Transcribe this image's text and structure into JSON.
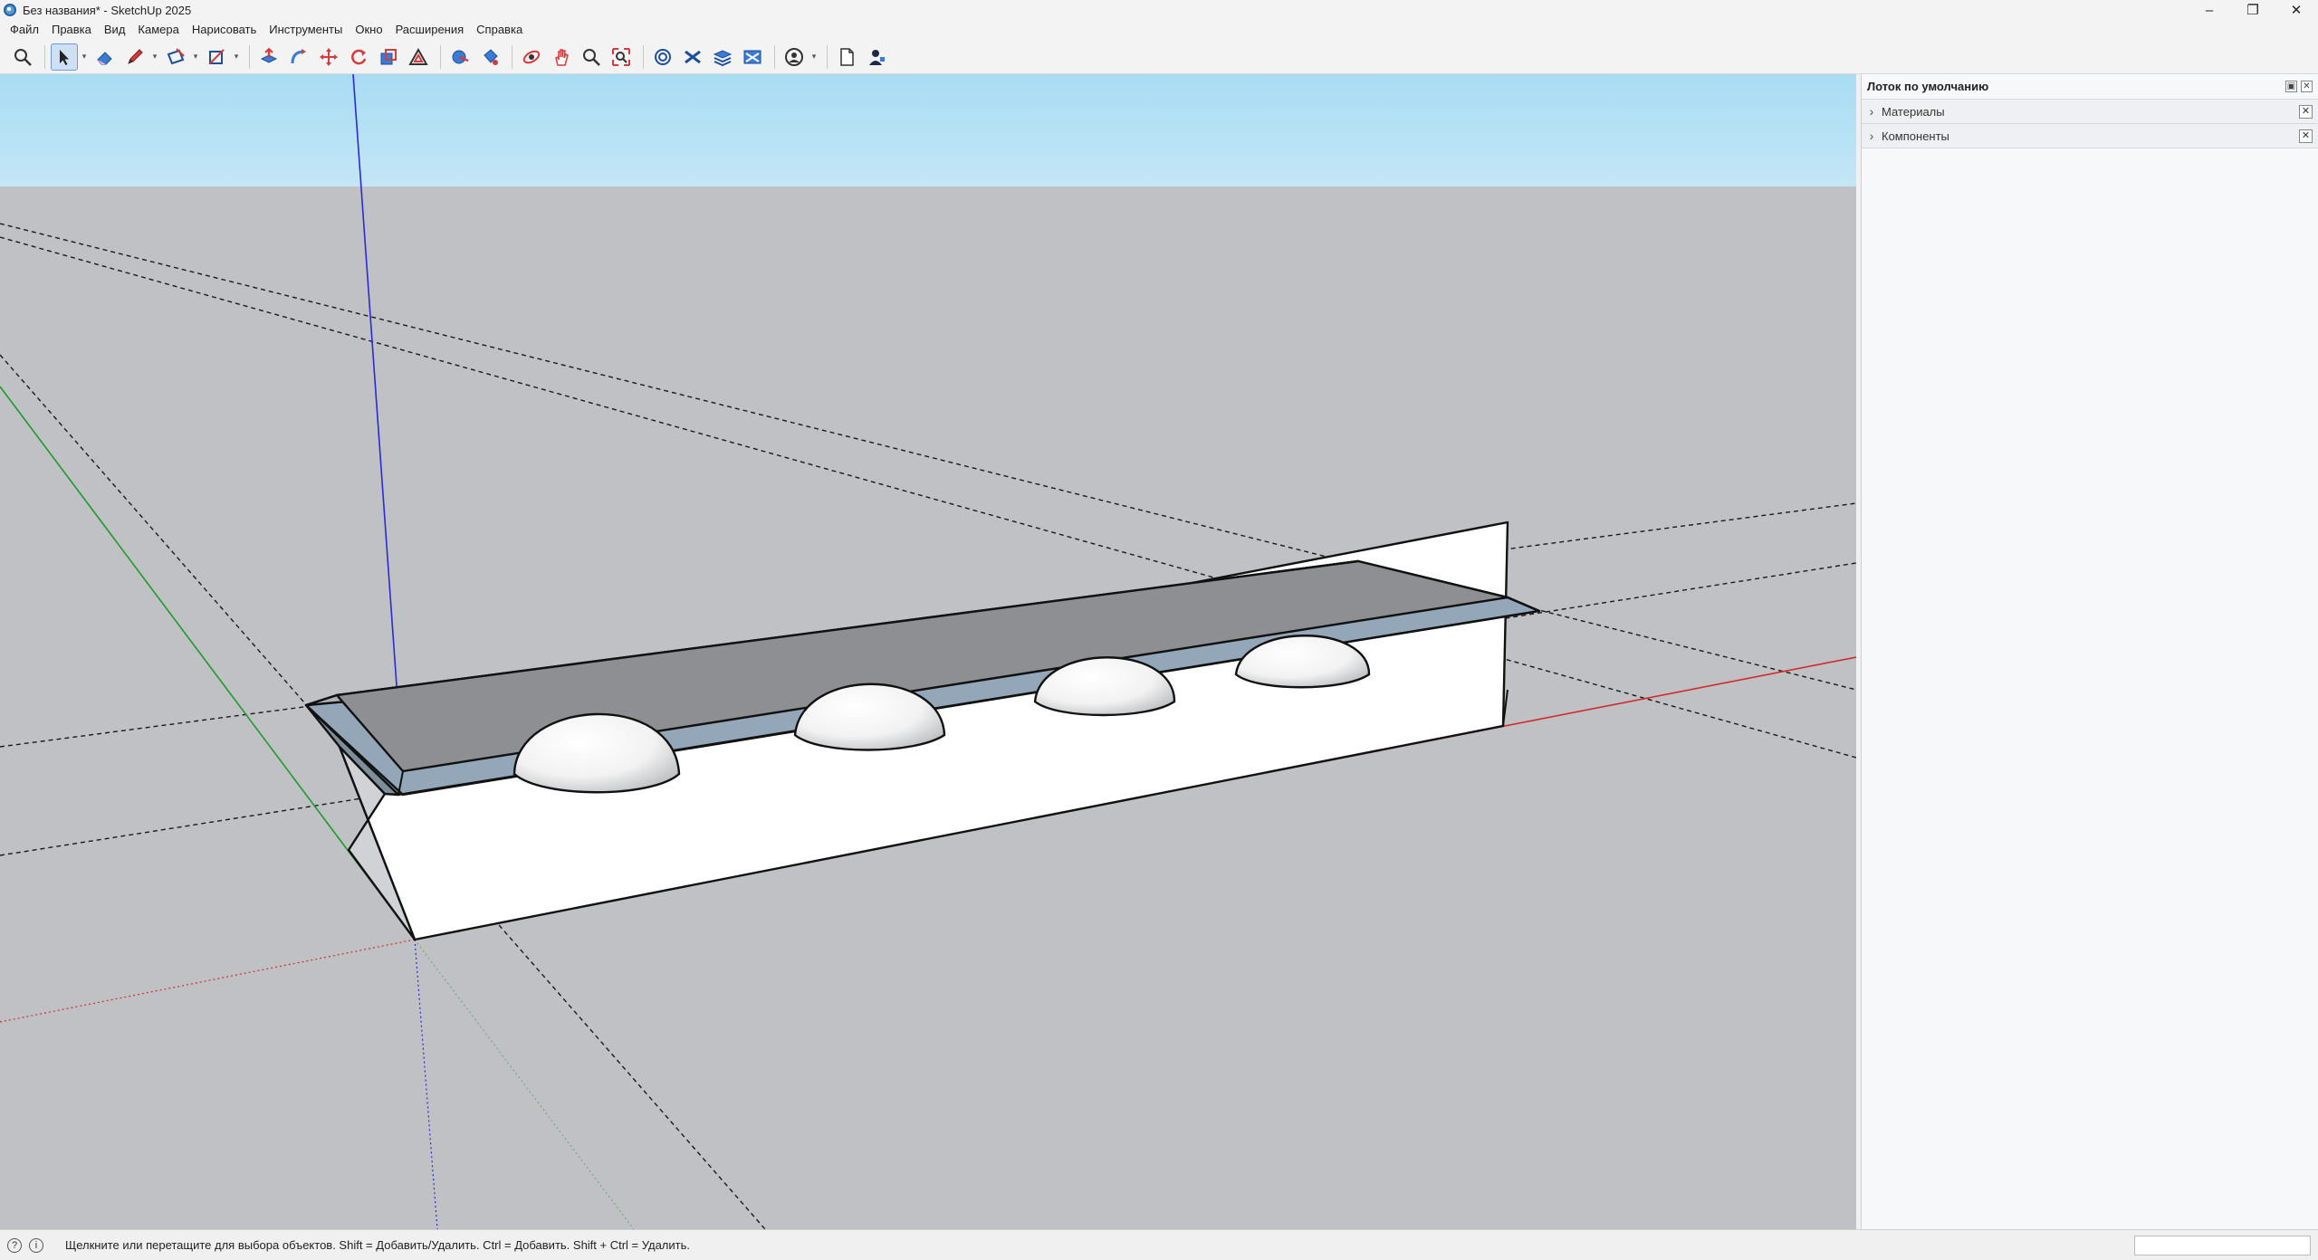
{
  "window": {
    "title": "Без названия* - SketchUp 2025",
    "controls": [
      "–",
      "❐",
      "✕"
    ]
  },
  "menu": [
    "Файл",
    "Правка",
    "Вид",
    "Камера",
    "Нарисовать",
    "Инструменты",
    "Окно",
    "Расширения",
    "Справка"
  ],
  "toolbar": {
    "tools": [
      "search-icon",
      "select-arrow-icon",
      "eraser-icon",
      "pencil-icon",
      "rectangle-icon",
      "shape-icon",
      "push-pull-icon",
      "follow-me-icon",
      "move-icon",
      "rotate-icon",
      "scale-icon",
      "offset-icon",
      "tape-measure-icon",
      "paint-bucket-icon",
      "orbit-icon",
      "pan-icon",
      "zoom-icon",
      "zoom-extents-icon",
      "3d-warehouse-icon",
      "extension-warehouse-icon",
      "layers-icon",
      "scenes-icon",
      "account-icon",
      "new-file-icon",
      "profile-icon"
    ]
  },
  "tray": {
    "title": "Лоток по умолчанию",
    "panels": [
      {
        "label": "Материалы"
      },
      {
        "label": "Компоненты"
      }
    ]
  },
  "status": {
    "text": "Щелкните или перетащите для выбора объектов. Shift = Добавить/Удалить. Ctrl = Добавить. Shift + Ctrl = Удалить."
  },
  "colors": {
    "sky": "#b3e0f4",
    "ground": "#bfc1c5",
    "axis_blue": "#2a2ad8",
    "axis_green": "#1f9a2a",
    "axis_red": "#d42a2a",
    "top_face": "#8d8f93",
    "bevel": "#93a7b8",
    "front_face": "#ffffff"
  }
}
